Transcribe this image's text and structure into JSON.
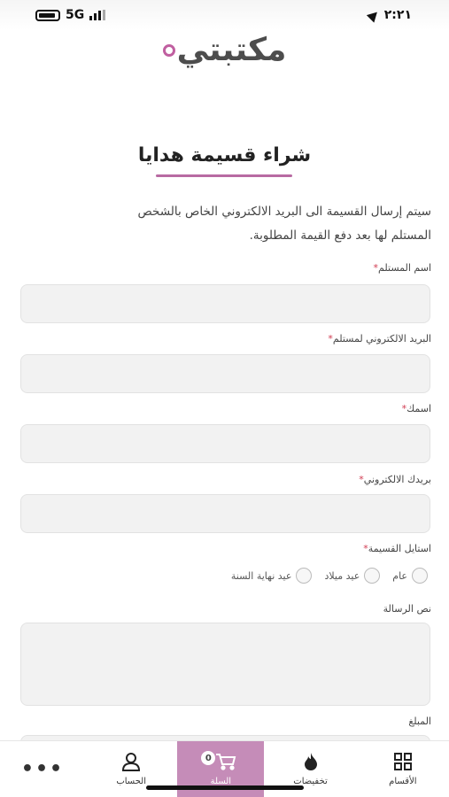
{
  "status_bar": {
    "network": "5G",
    "time": "٢:٢١"
  },
  "logo": {
    "text": "مكتبتي"
  },
  "page": {
    "title": "شراء قسيمة هدايا",
    "intro_line1": "سيتم إرسال القسيمة الى البريد الالكتروني الخاص بالشخص",
    "intro_line2": "المستلم لها بعد دفع القيمة المطلوبة."
  },
  "form": {
    "recipient_name_label": "اسم المستلم",
    "recipient_email_label": "البريد الالكتروني لمستلم",
    "your_name_label": "اسمك",
    "your_email_label": "بريدك الالكتروني",
    "voucher_style_label": "استايل القسيمة",
    "required_mark": "*",
    "styles": [
      "عام",
      "عيد ميلاد",
      "عيد نهاية السنة"
    ],
    "message_label": "نص الرسالة",
    "amount_label": "المبلغ"
  },
  "bottom_nav": {
    "categories": "الأقسام",
    "offers": "تخفيضات",
    "cart": "السلة",
    "cart_count": "0",
    "account": "الحساب",
    "more": "•••"
  },
  "colors": {
    "accent": "#c58cb8",
    "title_underline": "#b86aa2",
    "required": "#d03a50"
  }
}
